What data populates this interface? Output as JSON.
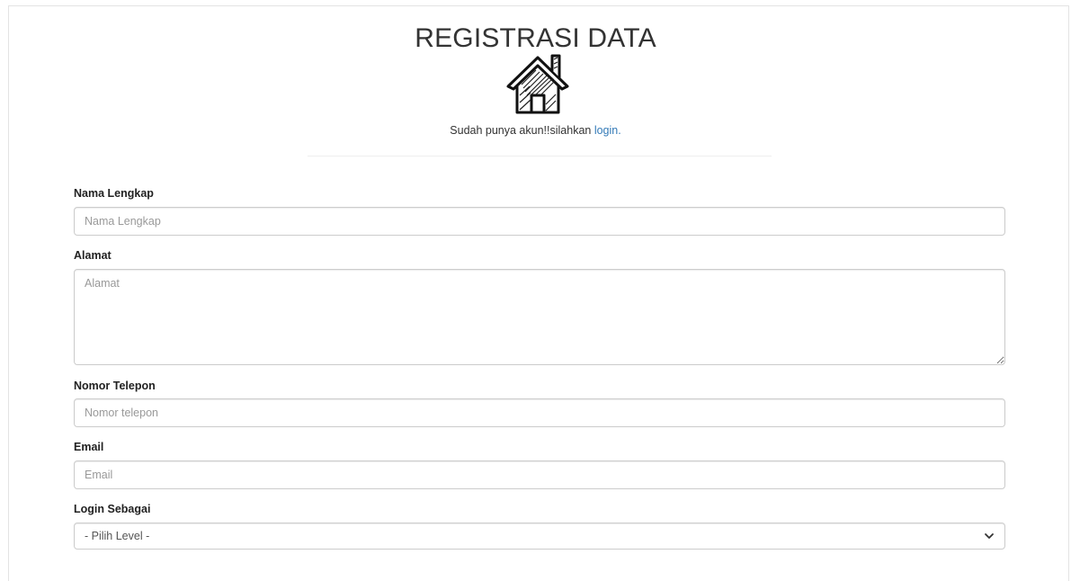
{
  "header": {
    "title": "REGISTRASI DATA",
    "logo_icon": "house-icon",
    "login_prompt": "Sudah punya akun!!silahkan",
    "login_link": "login."
  },
  "form": {
    "nama": {
      "label": "Nama Lengkap",
      "placeholder": "Nama Lengkap",
      "value": ""
    },
    "alamat": {
      "label": "Alamat",
      "placeholder": "Alamat",
      "value": ""
    },
    "telepon": {
      "label": "Nomor Telepon",
      "placeholder": "Nomor telepon",
      "value": ""
    },
    "email": {
      "label": "Email",
      "placeholder": "Email",
      "value": ""
    },
    "level": {
      "label": "Login Sebagai",
      "selected": "- Pilih Level -",
      "icon": "chevron-down-icon"
    }
  },
  "colors": {
    "link": "#337ab7",
    "border": "#cccccc",
    "text": "#333333"
  }
}
